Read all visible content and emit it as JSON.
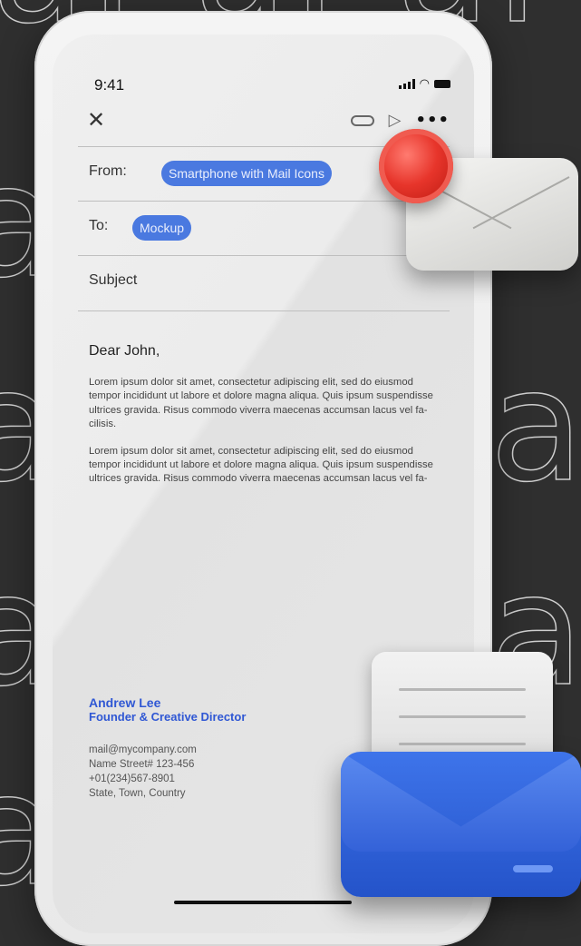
{
  "status_bar": {
    "time": "9:41"
  },
  "compose": {
    "close_icon": "close-icon",
    "from": {
      "label": "From:",
      "value": "Smartphone with Mail Icons"
    },
    "to": {
      "label": "To:",
      "value": "Mockup"
    },
    "subject": {
      "placeholder": "Subject"
    }
  },
  "message": {
    "greeting": "Dear John,",
    "paragraphs": [
      "Lorem ipsum dolor sit amet, consectetur adipiscing elit, sed do eiusmod tempor incididunt ut labore et dolore magna aliqua. Quis ipsum suspendisse ultrices gravida. Risus commodo viverra maecenas accumsan lacus vel fa-cilisis.",
      "Lorem ipsum dolor sit amet, consectetur adipiscing elit, sed do eiusmod tempor incididunt ut labore et dolore magna aliqua. Quis ipsum suspendisse ultrices gravida. Risus commodo viverra maecenas accumsan lacus vel fa-"
    ]
  },
  "signature": {
    "name": "Andrew Lee",
    "title": "Founder & Creative Director",
    "email": "mail@mycompany.com",
    "address": "Name Street# 123-456",
    "phone": "+01(234)567-8901",
    "location": "State, Town, Country"
  },
  "colors": {
    "accent": "#4a79e0",
    "background": "#2f2f2f",
    "badge": "#e7352b"
  }
}
